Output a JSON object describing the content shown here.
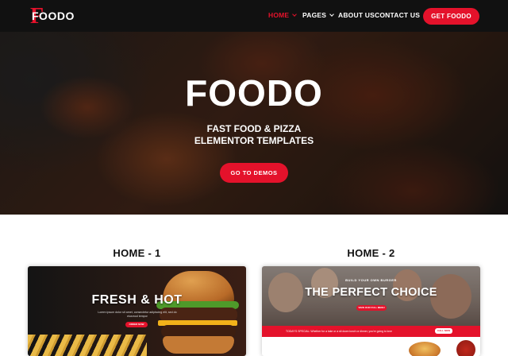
{
  "brand": {
    "name": "FOODO",
    "accent_color": "#e4122b"
  },
  "nav": {
    "items": [
      {
        "label": "HOME",
        "active": true,
        "has_dropdown": true
      },
      {
        "label": "PAGES",
        "active": false,
        "has_dropdown": true
      },
      {
        "label": "ABOUT US",
        "active": false,
        "has_dropdown": false
      },
      {
        "label": "CONTACT US",
        "active": false,
        "has_dropdown": false
      }
    ],
    "cta_label": "GET FOODO"
  },
  "hero": {
    "title": "FOODO",
    "subtitle_line1": "FAST FOOD & PIZZA",
    "subtitle_line2": "ELEMENTOR TEMPLATES",
    "button_label": "GO TO DEMOS"
  },
  "demos": [
    {
      "label": "HOME - 1",
      "preview": {
        "title": "FRESH & HOT",
        "text": "Lorem ipsum dolor sit amet, consectetur adipiscing elit, sed do eiusmod tempor",
        "button_label": "ORDER NOW"
      }
    },
    {
      "label": "HOME - 2",
      "preview": {
        "pretitle": "BUILD YOUR OWN BURGER",
        "title": "THE PERFECT CHOICE",
        "button_label": "VIEW OUR FULL MENU",
        "bar_text": "TODAY'S SPECIAL: Whether for a take or a sit down lunch or dinner, you're going to love",
        "bar_button_label": "CALL NOW"
      }
    }
  ]
}
